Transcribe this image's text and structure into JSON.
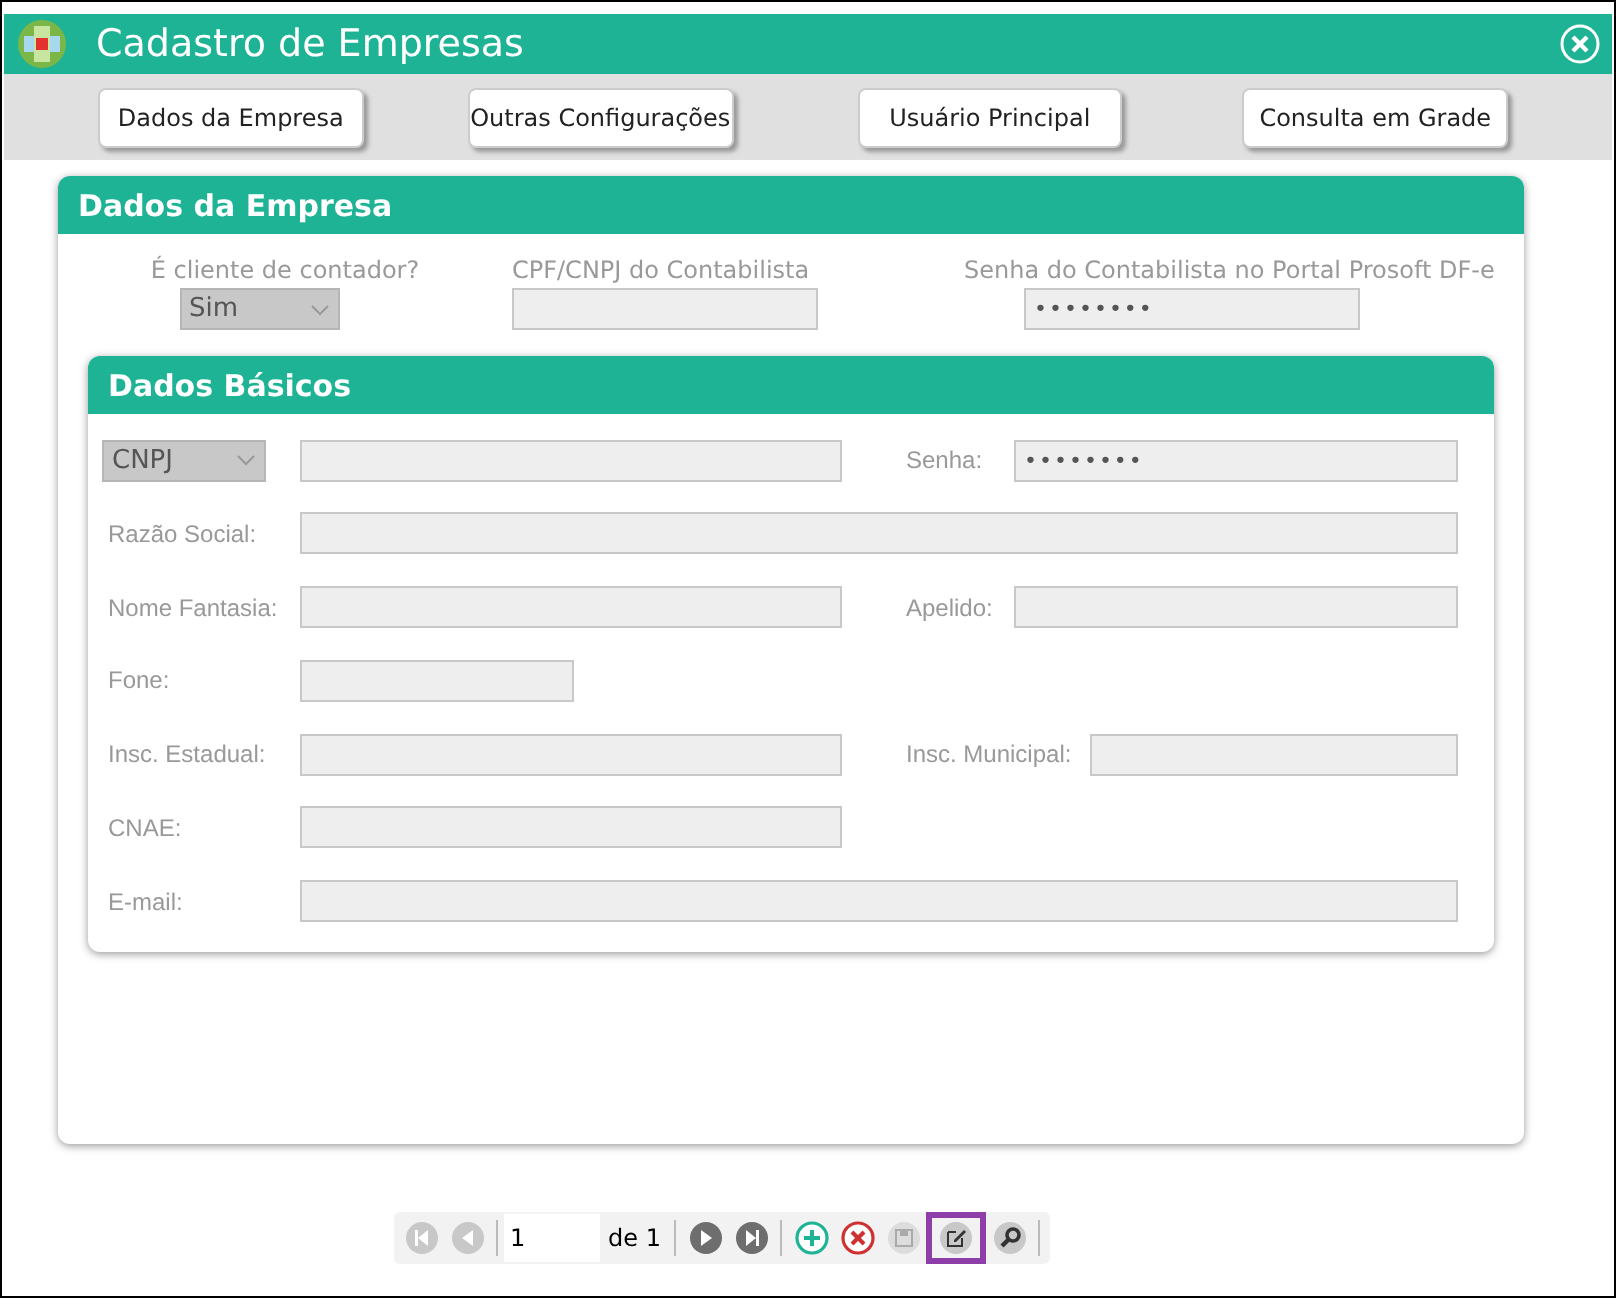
{
  "window": {
    "title": "Cadastro de Empresas"
  },
  "nav_buttons": [
    {
      "label": "Dados da Empresa"
    },
    {
      "label": "Outras Configurações"
    },
    {
      "label": "Usuário Principal"
    },
    {
      "label": "Consulta em Grade"
    }
  ],
  "dados_empresa": {
    "title": "Dados da Empresa",
    "fields": [
      {
        "label": "É cliente de contador?",
        "kind": "select",
        "value": "Sim",
        "disabled": true
      },
      {
        "label": "CPF/CNPJ do Contabilista",
        "kind": "text",
        "disabled": true
      },
      {
        "label": "Senha do Contabilista no Portal Prosoft DF-e",
        "kind": "password",
        "value": "••••••••",
        "disabled": true
      }
    ]
  },
  "dados_basicos": {
    "title": "Dados Básicos",
    "rows": [
      [
        {
          "kind": "select",
          "value": "CNPJ",
          "disabled": true
        },
        {
          "kind": "text",
          "disabled": true
        },
        {
          "label": "Senha:",
          "kind": "password",
          "value": "••••••••",
          "disabled": true
        }
      ],
      [
        {
          "label": "Razão Social:",
          "kind": "text",
          "disabled": true
        }
      ],
      [
        {
          "label": "Nome Fantasia:",
          "kind": "text",
          "disabled": true
        },
        {
          "label": "Apelido:",
          "kind": "text",
          "disabled": true
        }
      ],
      [
        {
          "label": "Fone:",
          "kind": "text",
          "disabled": true
        }
      ],
      [
        {
          "label": "Insc. Estadual:",
          "kind": "text",
          "disabled": true
        },
        {
          "label": "Insc. Municipal:",
          "kind": "text",
          "disabled": true
        }
      ],
      [
        {
          "label": "CNAE:",
          "kind": "text",
          "disabled": true
        }
      ],
      [
        {
          "label": "E-mail:",
          "kind": "text",
          "disabled": true
        }
      ]
    ]
  },
  "pager": {
    "page": "1",
    "of_label": "de 1",
    "buttons": [
      {
        "kind": "first",
        "disabled": true,
        "selected": false
      },
      {
        "kind": "prev",
        "disabled": true,
        "selected": false
      },
      {
        "kind": "separator"
      },
      {
        "kind": "next",
        "disabled": false,
        "selected": false
      },
      {
        "kind": "last",
        "disabled": false,
        "selected": false
      },
      {
        "kind": "separator"
      },
      {
        "kind": "add",
        "disabled": false,
        "selected": false
      },
      {
        "kind": "delete",
        "disabled": false,
        "selected": false
      },
      {
        "kind": "save",
        "disabled": true,
        "selected": false
      },
      {
        "kind": "edit",
        "disabled": false,
        "selected": true
      },
      {
        "kind": "search",
        "disabled": false,
        "selected": false
      }
    ]
  }
}
